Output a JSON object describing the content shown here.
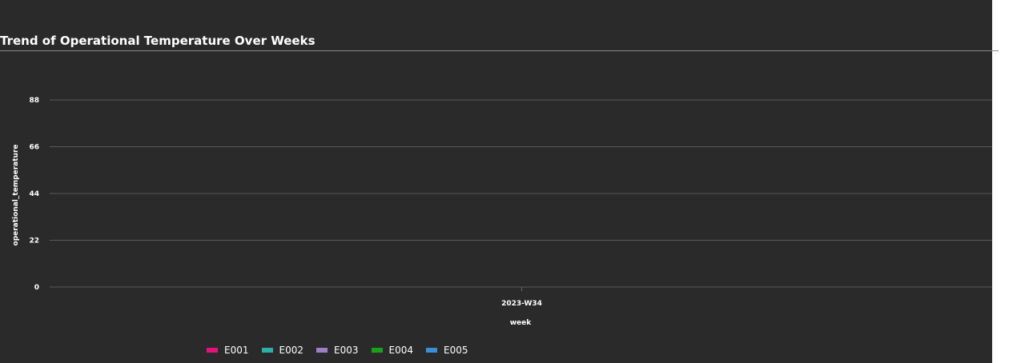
{
  "chart_data": {
    "type": "line",
    "title": "Trend of Operational Temperature Over Weeks",
    "xlabel": "week",
    "ylabel": "operational_temperature",
    "categories": [
      "2023-W34"
    ],
    "yticks": [
      0,
      22,
      44,
      66,
      88
    ],
    "ylim": [
      0,
      88
    ],
    "grid": true,
    "legend_position": "bottom-left",
    "series": [
      {
        "name": "E001",
        "color": "#e0147a",
        "values": [
          null
        ]
      },
      {
        "name": "E002",
        "color": "#2ab0a8",
        "values": [
          null
        ]
      },
      {
        "name": "E003",
        "color": "#9b80c8",
        "values": [
          null
        ]
      },
      {
        "name": "E004",
        "color": "#1aa01a",
        "values": [
          null
        ]
      },
      {
        "name": "E005",
        "color": "#3a8fd8",
        "values": [
          null
        ]
      }
    ]
  }
}
